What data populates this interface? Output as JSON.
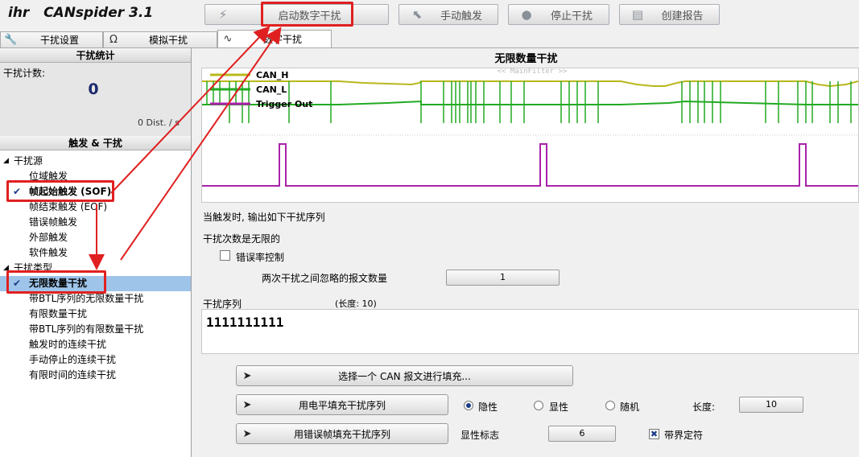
{
  "app": {
    "name": "ihr   CANspider 3.1"
  },
  "toolbar": {
    "start": "启动数字干扰",
    "manual": "手动触发",
    "stop": "停止干扰",
    "report": "创建报告"
  },
  "tabs": [
    {
      "label": "干扰设置"
    },
    {
      "label": "模拟干扰"
    },
    {
      "label": "数字干扰"
    }
  ],
  "stats": {
    "header": "干扰统计",
    "count_label": "干扰计数:",
    "count_value": "0",
    "rate": "0 Dist. / s"
  },
  "trigger": {
    "header": "触发 & 干扰",
    "source_group": "干扰源",
    "sources": [
      "位域触发",
      "帧起始触发 (SOF)",
      "帧结束触发 (EOF)",
      "错误帧触发",
      "外部触发",
      "软件触发"
    ],
    "type_group": "干扰类型",
    "types": [
      "无限数量干扰",
      "带BTL序列的无限数量干扰",
      "有限数量干扰",
      "带BTL序列的有限数量干扰",
      "触发时的连续干扰",
      "手动停止的连续干扰",
      "有限时间的连续干扰"
    ]
  },
  "scope": {
    "title": "无限数量干扰",
    "legend": [
      "CAN_H",
      "CAN_L",
      "Trigger Out"
    ],
    "watermark": "<< MainFilter >>"
  },
  "settings": {
    "on_trigger": "当触发时, 输出如下干扰序列",
    "count_unlimited": "干扰次数是无限的",
    "error_rate_label": "错误率控制",
    "ignore_label": "两次干扰之间忽略的报文数量",
    "ignore_value": "1",
    "seq_label": "干扰序列",
    "seq_length": "(长度: 10)",
    "sequence": "1111111111"
  },
  "actions": {
    "fill_can": "选择一个 CAN 报文进行填充...",
    "fill_level": "用电平填充干扰序列",
    "fill_error": "用错误帧填充干扰序列",
    "recessive": "隐性",
    "dominant": "显性",
    "random": "随机",
    "length_label": "长度:",
    "length_value": "10",
    "dominant_flag_label": "显性标志",
    "dominant_flag_value": "6",
    "stuff_label": "带界定符"
  },
  "colors": {
    "can_h": "#b8b81c",
    "can_l": "#22aa22",
    "trigger": "#aa22aa",
    "highlight": "#e02020",
    "selection": "#9fc4ea"
  }
}
